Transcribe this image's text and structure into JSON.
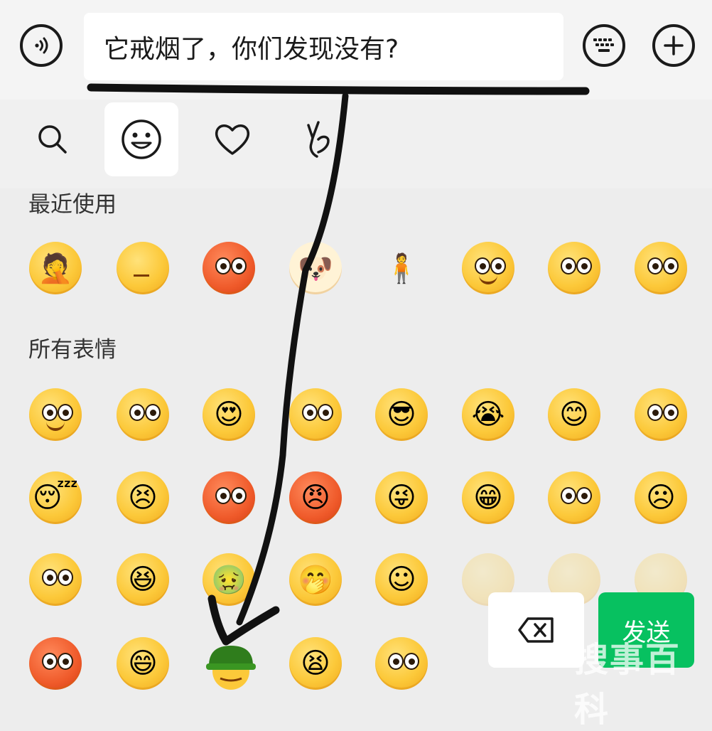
{
  "input": {
    "text": "它戒烟了，你们发现没有?"
  },
  "icons": {
    "voice": "voice-icon",
    "keyboard": "keyboard-icon",
    "add": "plus-icon",
    "search": "search-icon",
    "emoji_tab": "smiley-icon",
    "favorites_tab": "heart-icon",
    "gesture_tab": "victory-hand-icon",
    "delete": "backspace-icon"
  },
  "sections": {
    "recent": "最近使用",
    "all": "所有表情"
  },
  "buttons": {
    "send": "发送"
  },
  "watermark": "搜事百科",
  "colors": {
    "send_green": "#07c160",
    "emoji_yellow": "#fcc93a",
    "annotation_ink": "#111111"
  }
}
